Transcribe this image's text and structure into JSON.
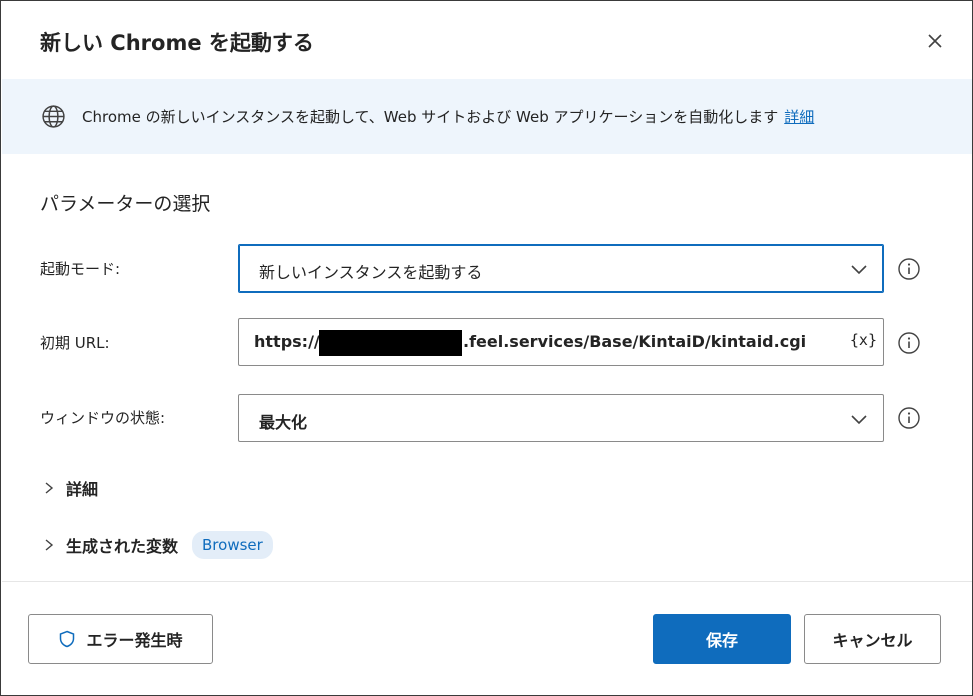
{
  "dialog": {
    "title": "新しい Chrome を起動する",
    "close_icon": "close-icon"
  },
  "info_banner": {
    "icon": "globe-icon",
    "text": "Chrome の新しいインスタンスを起動して、Web サイトおよび Web アプリケーションを自動化します",
    "link": "詳細"
  },
  "section": {
    "title": "パラメーターの選択"
  },
  "fields": {
    "launch_mode": {
      "label": "起動モード:",
      "value": "新しいインスタンスを起動する"
    },
    "initial_url": {
      "label": "初期 URL:",
      "value_prefix": "https://",
      "value_suffix": ".feel.services/Base/KintaiD/kintaid.cgi",
      "variable_button": "{x}"
    },
    "window_state": {
      "label": "ウィンドウの状態:",
      "value": "最大化"
    }
  },
  "expanders": {
    "advanced": {
      "label": "詳細"
    },
    "generated_variables": {
      "label": "生成された変数",
      "badge": "Browser"
    }
  },
  "footer": {
    "on_error_label": "エラー発生時",
    "save_label": "保存",
    "cancel_label": "キャンセル"
  },
  "colors": {
    "accent": "#0f6cbd",
    "banner_bg": "#eef5fc",
    "badge_bg": "#e3edf8"
  }
}
